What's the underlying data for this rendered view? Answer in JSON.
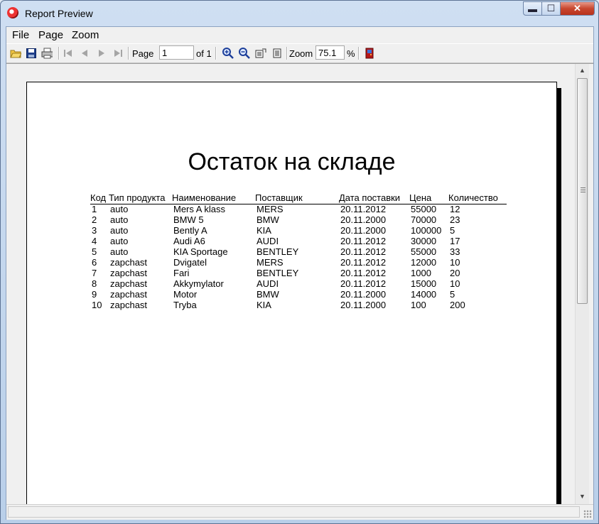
{
  "window": {
    "title": "Report Preview",
    "min_label": "▬",
    "max_label": "☐",
    "close_label": "✕"
  },
  "menu": {
    "file": "File",
    "page": "Page",
    "zoom": "Zoom"
  },
  "toolbar": {
    "page_label": "Page",
    "page_value": "1",
    "of_label": "of 1",
    "zoom_label": "Zoom",
    "zoom_value": "75.1",
    "percent_label": "%"
  },
  "report": {
    "title": "Остаток на складе",
    "headers": [
      "Код",
      "Тип продукта",
      "Наименование",
      "Поставщик",
      "Дата поставки",
      "Цена",
      "Количество"
    ],
    "rows": [
      [
        "1",
        "auto",
        "Mers A klass",
        "MERS",
        "20.11.2012",
        "55000",
        "12"
      ],
      [
        "2",
        "auto",
        "BMW 5",
        "BMW",
        "20.11.2000",
        "70000",
        "23"
      ],
      [
        "3",
        "auto",
        "Bently A",
        "KIA",
        "20.11.2000",
        "100000",
        "5"
      ],
      [
        "4",
        "auto",
        "Audi A6",
        "AUDI",
        "20.11.2012",
        "30000",
        "17"
      ],
      [
        "5",
        "auto",
        "KIA Sportage",
        "BENTLEY",
        "20.11.2012",
        "55000",
        "33"
      ],
      [
        "6",
        "zapchast",
        "Dvigatel",
        "MERS",
        "20.11.2012",
        "12000",
        "10"
      ],
      [
        "7",
        "zapchast",
        "Fari",
        "BENTLEY",
        "20.11.2012",
        "1000",
        "20"
      ],
      [
        "8",
        "zapchast",
        "Akkymylator",
        "AUDI",
        "20.11.2012",
        "15000",
        "10"
      ],
      [
        "9",
        "zapchast",
        "Motor",
        "BMW",
        "20.11.2000",
        "14000",
        "5"
      ],
      [
        "10",
        "zapchast",
        "Tryba",
        "KIA",
        "20.11.2000",
        "100",
        "200"
      ]
    ]
  }
}
